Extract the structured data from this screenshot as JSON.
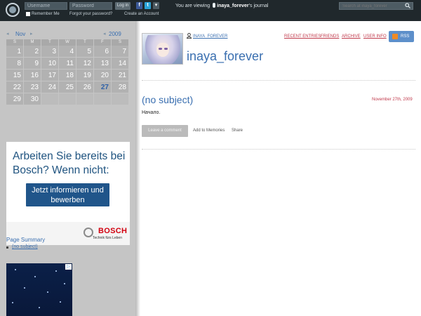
{
  "topbar": {
    "username_placeholder": "Username",
    "password_placeholder": "Password",
    "login_label": "Log in",
    "remember_me": "Remember Me",
    "forgot_password": "Forgot your password?",
    "create_account": "Create an Account",
    "viewing_prefix": "You are viewing",
    "viewing_user": "inaya_forever",
    "viewing_suffix": "'s journal",
    "search_placeholder": "Search at inaya_forever",
    "facebook_icon": "f",
    "twitter_icon": "t",
    "dropdown_icon": "▾"
  },
  "calendar": {
    "prev_month_arrow": "◂",
    "month": "Nov",
    "next_month_arrow": "▸",
    "prev_year_arrow": "◂",
    "year": "2009",
    "day_headers": [
      "S",
      "M",
      "T",
      "W",
      "T",
      "F",
      "S"
    ],
    "weeks": [
      [
        "1",
        "2",
        "3",
        "4",
        "5",
        "6",
        "7"
      ],
      [
        "8",
        "9",
        "10",
        "11",
        "12",
        "13",
        "14"
      ],
      [
        "15",
        "16",
        "17",
        "18",
        "19",
        "20",
        "21"
      ],
      [
        "22",
        "23",
        "24",
        "25",
        "26",
        "27",
        "28"
      ],
      [
        "29",
        "30",
        "",
        "",
        "",
        "",
        ""
      ]
    ],
    "today": "27"
  },
  "ad": {
    "headline": "Arbeiten Sie bereits bei Bosch? Wenn nicht:",
    "button": "Jetzt informieren und bewerben",
    "brand": "BOSCH",
    "tagline": "Technik fürs Leben"
  },
  "summary": {
    "title": "Page Summary",
    "items": [
      "(no subject)"
    ]
  },
  "adchoices_icon": "▷",
  "header": {
    "user_link": "INAYA_FOREVER",
    "journal_name": "inaya_forever",
    "nav": [
      "RECENT ENTRIES",
      "FRIENDS",
      "ARCHIVE",
      "USER INFO"
    ],
    "rss_label": "RSS"
  },
  "entry": {
    "title": "(no subject)",
    "date": "November 27th, 2009",
    "body": "Начало.",
    "leave_comment": "Leave a comment",
    "add_to_memories": "Add to Memories",
    "share": "Share"
  },
  "colors": {
    "topbar": "#20282c",
    "sidebar": "#c5c5c5",
    "link_blue": "#3a6fb0",
    "nav_red": "#c0394b",
    "ad_button": "#20558a",
    "rss": "#5d8fca"
  }
}
